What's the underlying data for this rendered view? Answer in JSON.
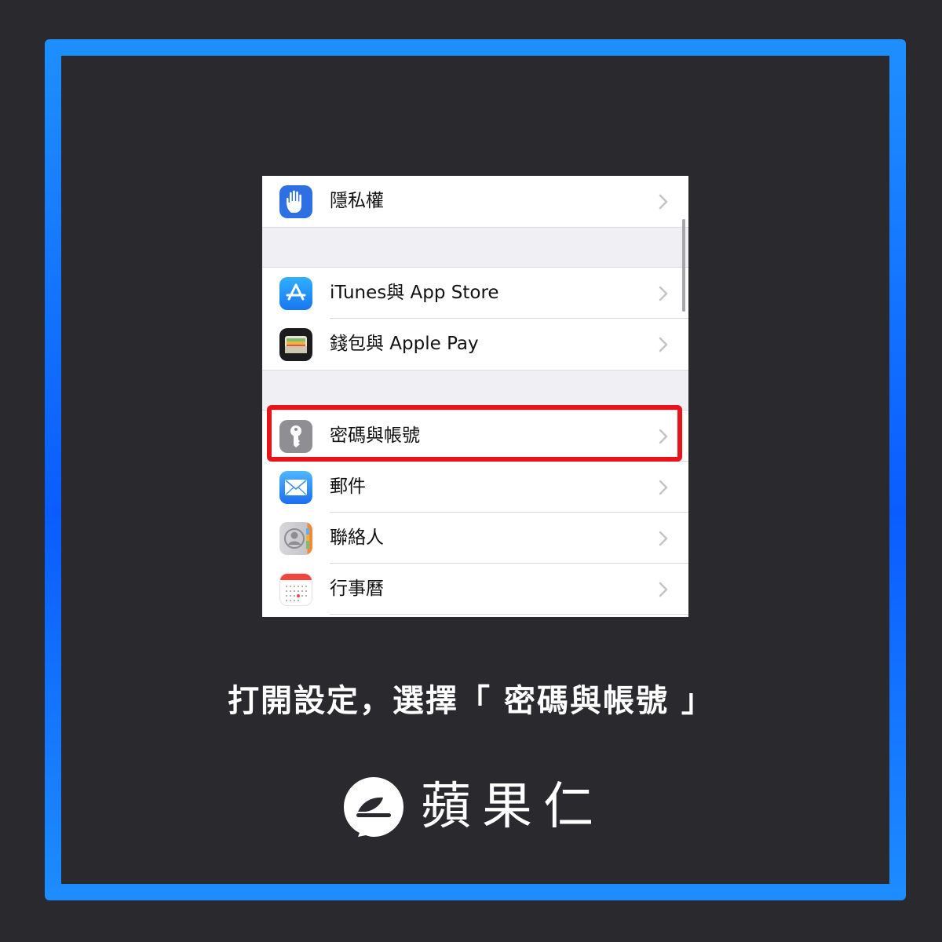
{
  "settings_list": {
    "items": [
      {
        "label": "隱私權",
        "icon": "hand-icon",
        "icon_color": "#2f6fe4"
      },
      {
        "label": "iTunes與 App Store",
        "icon": "app-store-icon",
        "icon_color": "#1b8cf5"
      },
      {
        "label": "錢包與 Apple Pay",
        "icon": "wallet-icon",
        "icon_color": "#1c1c1e"
      },
      {
        "label": "密碼與帳號",
        "icon": "key-icon",
        "icon_color": "#8e8e93"
      },
      {
        "label": "郵件",
        "icon": "mail-icon",
        "icon_color": "#2f8bf0"
      },
      {
        "label": "聯絡人",
        "icon": "contacts-icon",
        "icon_color": "#c9c9ce"
      },
      {
        "label": "行事曆",
        "icon": "calendar-icon",
        "icon_color": "#ffffff"
      }
    ],
    "highlighted_item": "密碼與帳號"
  },
  "caption": "打開設定，選擇「 密碼與帳號 」",
  "brand": {
    "name": "蘋果仁",
    "logo_icon": "applealmond-logo-icon"
  },
  "colors": {
    "background": "#2a2a2e",
    "frame_blue": "#1b7dff",
    "highlight_red": "#e8131b",
    "grouped_background": "#efeff4"
  }
}
